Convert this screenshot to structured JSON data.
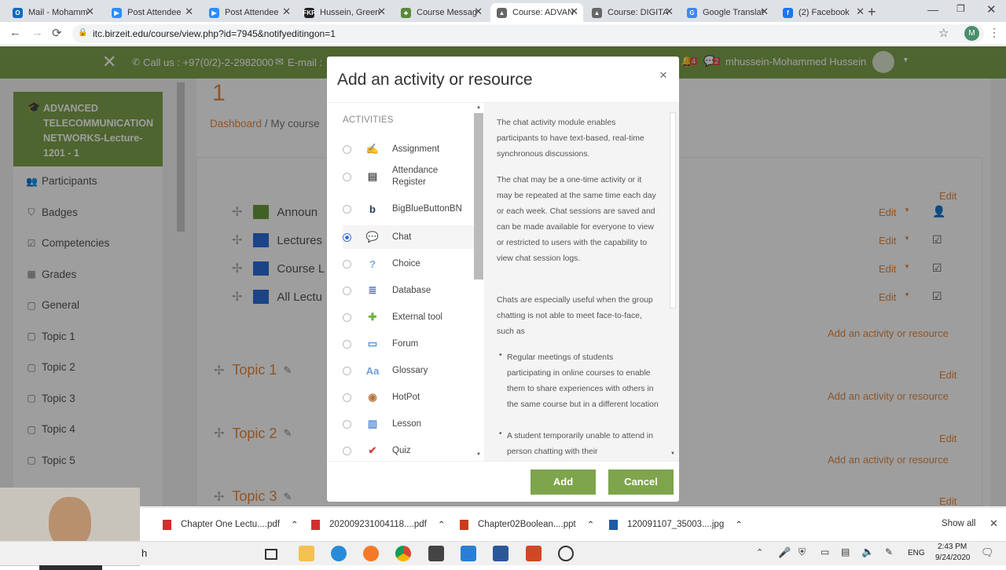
{
  "browser": {
    "tabs": [
      {
        "label": "Mail - Mohamm",
        "favicon_color": "#0f6cbd",
        "favicon_text": "O"
      },
      {
        "label": "Post Attendee",
        "favicon_color": "#2d8cff",
        "favicon_text": "▶"
      },
      {
        "label": "Post Attendee",
        "favicon_color": "#2d8cff",
        "favicon_text": "▶"
      },
      {
        "label": "Hussein, Green",
        "favicon_color": "#222222",
        "favicon_text": "FKP"
      },
      {
        "label": "Course Messag",
        "favicon_color": "#5a8a3a",
        "favicon_text": "♣"
      },
      {
        "label": "Course: ADVAN",
        "favicon_color": "#666666",
        "favicon_text": "▲"
      },
      {
        "label": "Course: DIGITA",
        "favicon_color": "#666666",
        "favicon_text": "▲"
      },
      {
        "label": "Google Translat",
        "favicon_color": "#4285f4",
        "favicon_text": "G"
      },
      {
        "label": "(2) Facebook",
        "favicon_color": "#1877f2",
        "favicon_text": "f"
      }
    ],
    "active_tab_index": 5,
    "url": "itc.birzeit.edu/course/view.php?id=7945&notifyeditingon=1",
    "profile_initial": "M"
  },
  "header": {
    "contact": "Call us : +97(0/2)-2-2982000",
    "email_label": "E-mail :",
    "user_name": "mhussein-Mohammed Hussein",
    "message_count": "4",
    "notification_count": "2"
  },
  "sidebar": {
    "course_title": "ADVANCED TELECOMMUNICATION NETWORKS-Lecture-1201 - 1",
    "items": [
      {
        "label": "Participants",
        "icon": "users-icon"
      },
      {
        "label": "Badges",
        "icon": "shield-icon"
      },
      {
        "label": "Competencies",
        "icon": "check-square-icon"
      },
      {
        "label": "Grades",
        "icon": "table-icon"
      },
      {
        "label": "General",
        "icon": "folder-icon"
      },
      {
        "label": "Topic 1",
        "icon": "folder-icon"
      },
      {
        "label": "Topic 2",
        "icon": "folder-icon"
      },
      {
        "label": "Topic 3",
        "icon": "folder-icon"
      },
      {
        "label": "Topic 4",
        "icon": "folder-icon"
      },
      {
        "label": "Topic 5",
        "icon": "folder-icon"
      }
    ]
  },
  "main": {
    "heading_number": "1",
    "breadcrumb": [
      "Dashboard",
      "My course"
    ],
    "resources": [
      "Announ",
      "Lectures",
      "Course L",
      "All Lectu"
    ],
    "topics": [
      "Topic 1",
      "Topic 2",
      "Topic 3"
    ],
    "edit_label": "Edit",
    "add_activity_label": "Add an activity or resource"
  },
  "modal": {
    "title": "Add an activity or resource",
    "section_label": "ACTIVITIES",
    "selected": "Chat",
    "activities": [
      {
        "label": "Assignment",
        "icon": "assignment-icon",
        "color": "#c9a46a"
      },
      {
        "label": "Attendance Register",
        "icon": "attendance-register-icon",
        "color": "#555555"
      },
      {
        "label": "BigBlueButtonBN",
        "icon": "bigbluebutton-icon",
        "color": "#283a5e"
      },
      {
        "label": "Chat",
        "icon": "chat-icon",
        "color": "#f0b429"
      },
      {
        "label": "Choice",
        "icon": "choice-icon",
        "color": "#7aa6e0"
      },
      {
        "label": "Database",
        "icon": "database-icon",
        "color": "#4a74c9"
      },
      {
        "label": "External tool",
        "icon": "puzzle-icon",
        "color": "#6fb43f"
      },
      {
        "label": "Forum",
        "icon": "forum-icon",
        "color": "#4a90d9"
      },
      {
        "label": "Glossary",
        "icon": "glossary-icon",
        "color": "#6f9fd8"
      },
      {
        "label": "HotPot",
        "icon": "hotpot-icon",
        "color": "#b5763c"
      },
      {
        "label": "Lesson",
        "icon": "lesson-icon",
        "color": "#5b8fd6"
      },
      {
        "label": "Quiz",
        "icon": "quiz-icon",
        "color": "#d64545"
      }
    ],
    "description": {
      "p1": "The chat activity module enables participants to have text-based, real-time synchronous discussions.",
      "p2": "The chat may be a one-time activity or it may be repeated at the same time each day or each week. Chat sessions are saved and can be made available for everyone to view or restricted to users with the capability to view chat session logs.",
      "p3": "Chats are especially useful when the group chatting is not able to meet face-to-face, such as",
      "bullets": [
        "Regular meetings of students participating in online courses to enable them to share experiences with others in the same course but in a different location",
        "A student temporarily unable to attend in person chatting with their"
      ]
    },
    "add_button": "Add",
    "cancel_button": "Cancel",
    "accent_color": "#7ea44c"
  },
  "downloads": {
    "items": [
      {
        "name": "Chapter One Lectu....pdf",
        "icon": "pdf-icon"
      },
      {
        "name": "202009231004118....pdf",
        "icon": "pdf-icon"
      },
      {
        "name": "Chapter02Boolean....ppt",
        "icon": "ppt-icon"
      },
      {
        "name": "120091107_35003....jpg",
        "icon": "image-icon"
      }
    ],
    "show_all": "Show all"
  },
  "taskbar": {
    "search_text": "h",
    "language": "ENG",
    "time": "2:43 PM",
    "date": "9/24/2020"
  }
}
